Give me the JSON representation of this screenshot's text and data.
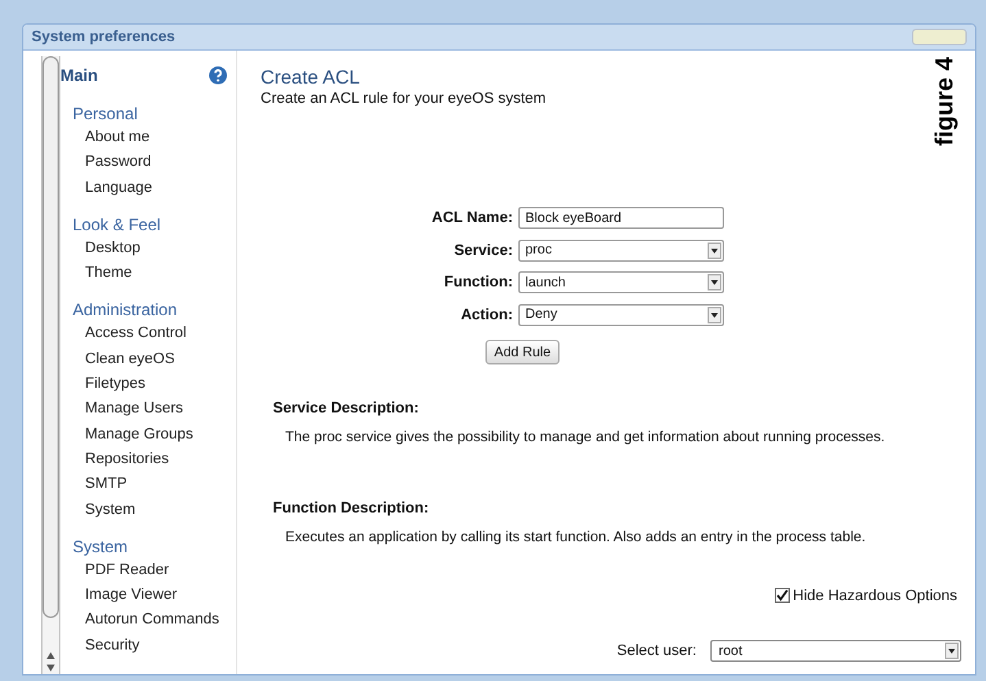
{
  "window": {
    "title": "System preferences"
  },
  "figure_label": "figure 4",
  "sidebar": {
    "title": "Main",
    "sections": [
      {
        "label": "Personal",
        "items": [
          "About me",
          "Password",
          "Language"
        ]
      },
      {
        "label": "Look & Feel",
        "items": [
          "Desktop",
          "Theme"
        ]
      },
      {
        "label": "Administration",
        "items": [
          "Access Control",
          "Clean eyeOS",
          "Filetypes",
          "Manage Users",
          "Manage Groups",
          "Repositories",
          "SMTP",
          "System"
        ]
      },
      {
        "label": "System",
        "items": [
          "PDF Reader",
          "Image Viewer",
          "Autorun Commands",
          "Security"
        ]
      }
    ]
  },
  "content": {
    "title": "Create ACL",
    "subtitle": "Create an ACL rule for your eyeOS system",
    "fields": [
      {
        "kind": "text",
        "label": "ACL Name:",
        "value": "Block eyeBoard"
      },
      {
        "kind": "select",
        "label": "Service:",
        "value": "proc"
      },
      {
        "kind": "select",
        "label": "Function:",
        "value": "launch"
      },
      {
        "kind": "select",
        "label": "Action:",
        "value": "Deny"
      }
    ],
    "button": "Add Rule",
    "descriptions": [
      {
        "heading": "Service Description:",
        "text": "The proc service gives the possibility to manage and get information about running processes."
      },
      {
        "heading": "Function Description:",
        "text": "Executes an application by calling its start function. Also adds an entry in the process table."
      }
    ],
    "hide_hazardous": {
      "label": "Hide Hazardous Options",
      "checked": true
    },
    "select_user": {
      "label": "Select user:",
      "value": "root"
    }
  }
}
